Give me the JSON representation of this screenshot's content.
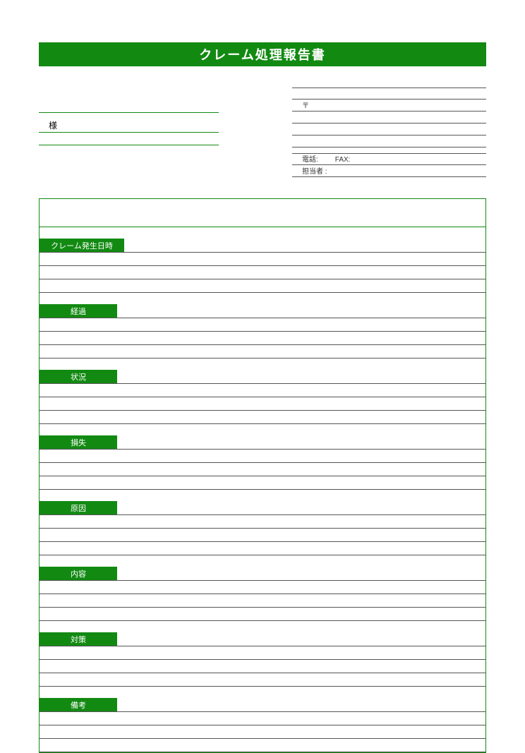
{
  "title": "クレーム処理報告書",
  "recipient_suffix": "様",
  "sender": {
    "postal_prefix": "〒",
    "tel_label": "電話:",
    "fax_label": "FAX:",
    "person_label": "担当者 :"
  },
  "sections": [
    {
      "label": "クレーム発生日時",
      "rows": 3
    },
    {
      "label": "経過",
      "rows": 3
    },
    {
      "label": "状況",
      "rows": 3
    },
    {
      "label": "損失",
      "rows": 3
    },
    {
      "label": "原因",
      "rows": 3
    },
    {
      "label": "内容",
      "rows": 3
    },
    {
      "label": "対策",
      "rows": 3
    },
    {
      "label": "備考",
      "rows": 3
    }
  ]
}
